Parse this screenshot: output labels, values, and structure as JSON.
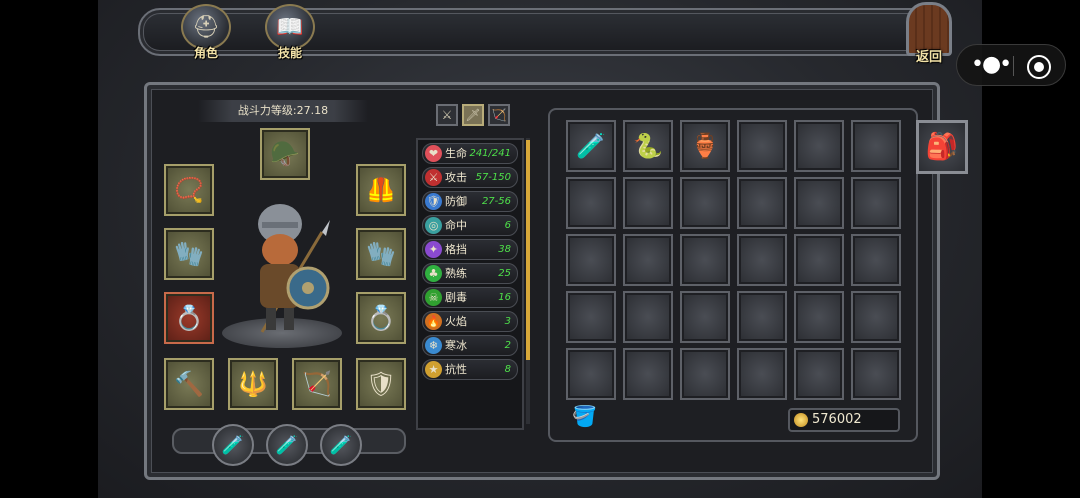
{
  "top": {
    "role_label": "角色",
    "skill_label": "技能",
    "back_label": "返回"
  },
  "character": {
    "power_text": "战斗力等级:27.18",
    "equipment": [
      {
        "name": "helmet",
        "icon": "🪖"
      },
      {
        "name": "necklace",
        "icon": "📿"
      },
      {
        "name": "armor",
        "icon": "🦺"
      },
      {
        "name": "gloves",
        "icon": "🧤"
      },
      {
        "name": "gauntlet",
        "icon": "🧤"
      },
      {
        "name": "ring-red",
        "icon": "💍"
      },
      {
        "name": "ring",
        "icon": "💍"
      },
      {
        "name": "mace",
        "icon": "🔨"
      },
      {
        "name": "spear",
        "icon": "🔱"
      },
      {
        "name": "crossbow",
        "icon": "🏹"
      },
      {
        "name": "shield",
        "icon": "🛡"
      }
    ],
    "potions": [
      "🧪",
      "🧪",
      "🧪"
    ]
  },
  "weapon_tabs": [
    "⚔",
    "🗡",
    "🏹"
  ],
  "stats": [
    {
      "name": "生命",
      "value": "241/241",
      "icon": "❤",
      "color": "#e0505a"
    },
    {
      "name": "攻击",
      "value": "57-150",
      "icon": "⚔",
      "color": "#c03030"
    },
    {
      "name": "防御",
      "value": "27-56",
      "icon": "🛡",
      "color": "#3a7ad0"
    },
    {
      "name": "命中",
      "value": "6",
      "icon": "◎",
      "color": "#3aa0a0"
    },
    {
      "name": "格挡",
      "value": "38",
      "icon": "✦",
      "color": "#8a4ad0"
    },
    {
      "name": "熟练",
      "value": "25",
      "icon": "♣",
      "color": "#30b040"
    },
    {
      "name": "剧毒",
      "value": "16",
      "icon": "☠",
      "color": "#30a030"
    },
    {
      "name": "火焰",
      "value": "3",
      "icon": "🔥",
      "color": "#d07020"
    },
    {
      "name": "寒冰",
      "value": "2",
      "icon": "❄",
      "color": "#3a8ad0"
    },
    {
      "name": "抗性",
      "value": "8",
      "icon": "★",
      "color": "#d0a030"
    }
  ],
  "inventory": {
    "items": [
      "🧪",
      "🐍",
      "🏺"
    ],
    "gold": "576002"
  }
}
